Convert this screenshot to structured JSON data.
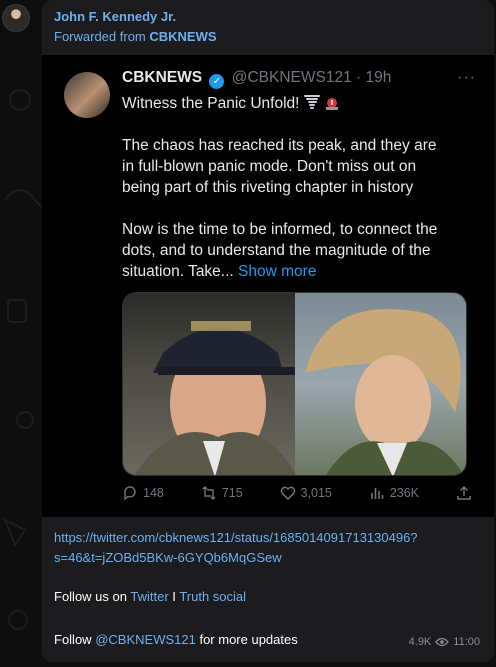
{
  "sender": {
    "name": "John F. Kennedy Jr.",
    "forwarded_prefix": "Forwarded from",
    "forwarded_from": "CBKNEWS"
  },
  "tweet": {
    "name": "CBKNEWS",
    "handle": "@CBKNEWS121",
    "separator": "·",
    "time": "19h",
    "more": "···",
    "line1": "Witness the Panic Unfold!",
    "p2_l1": "The chaos has reached its peak, and they are",
    "p2_l2": "in full-blown panic mode. Don't miss out on",
    "p2_l3": "being part of this riveting chapter in history",
    "p3_l1": "Now is the time to be informed, to connect the",
    "p3_l2": "dots, and to understand the magnitude of the",
    "p3_l3": "situation. Take...",
    "show_more": "Show more",
    "replies": "148",
    "retweets": "715",
    "likes": "3,015",
    "views": "236K"
  },
  "caption": {
    "url_l1": "https://twitter.com/cbknews121/status/1685014091713130496?",
    "url_l2": "s=46&t=jZOBd5BKw-6GYQb6MqGSew",
    "follow_us": "Follow us on",
    "twitter": "Twitter",
    "divider": "I",
    "truth_social": "Truth social",
    "follow": "Follow",
    "handle": "@CBKNEWS121",
    "updates": "for more updates"
  },
  "meta": {
    "views": "4.9K",
    "time": "11:00"
  },
  "colors": {
    "link": "#6cb0f2",
    "bubble": "#1c1c1e",
    "tweet_bg": "#000000",
    "verified": "#1d9bf0"
  }
}
